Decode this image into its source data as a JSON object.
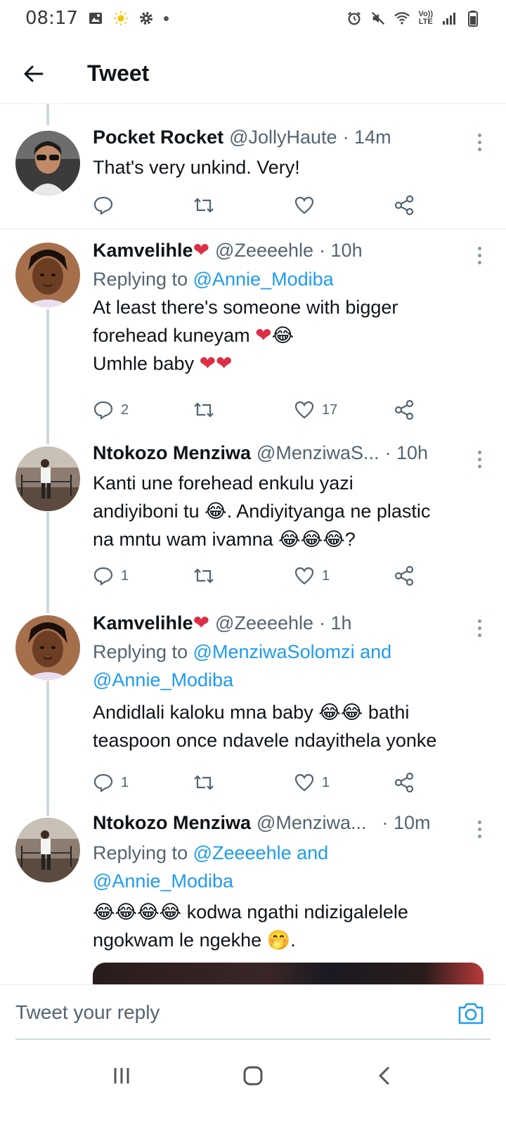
{
  "status_bar": {
    "time": "08:17",
    "left_icons": [
      "image-icon",
      "sun-icon",
      "settings-icon",
      "dot-icon"
    ],
    "right_icons": [
      "alarm-icon",
      "mute-icon",
      "wifi-icon",
      "volte-icon",
      "signal-icon",
      "battery-icon"
    ],
    "volte_label_top": "Vo))",
    "volte_label_bottom": "LTE"
  },
  "header": {
    "title": "Tweet"
  },
  "tweets": [
    {
      "name": "Pocket Rocket",
      "handle": "@JollyHaute",
      "time": "· 14m",
      "replying_prefix": "",
      "replying_to": "",
      "text_lines": [
        "That's very unkind. Very!"
      ],
      "replies": "",
      "likes": ""
    },
    {
      "name": "Kamvelihle",
      "handle": "@Zeeeehle",
      "time": "· 10h",
      "replying_prefix": "Replying to",
      "replying_to": "@Annie_Modiba",
      "text_lines": [
        "At least there's someone with bigger",
        "forehead kuneyam",
        "Umhle baby"
      ],
      "replies": "2",
      "likes": "17"
    },
    {
      "name": "Ntokozo Menziwa",
      "handle": "@MenziwaS...",
      "time": "· 10h",
      "replying_prefix": "",
      "replying_to": "",
      "text_lines": [
        "Kanti une forehead enkulu yazi",
        "andiyiboni tu",
        ". Andiyityanga ne plastic",
        "na mntu wam ivamna",
        "?"
      ],
      "replies": "1",
      "likes": "1"
    },
    {
      "name": "Kamvelihle",
      "handle": "@Zeeeehle",
      "time": "· 1h",
      "replying_prefix": "Replying to",
      "replying_to": "@MenziwaSolomzi and",
      "replying_to_2": "@Annie_Modiba",
      "text_lines": [
        "Andidlali kaloku mna baby",
        "bathi",
        "teaspoon once ndavele ndayithela yonke"
      ],
      "replies": "1",
      "likes": "1"
    },
    {
      "name": "Ntokozo Menziwa",
      "handle": "@Menziwa...",
      "time": "· 10m",
      "replying_prefix": "Replying to",
      "replying_to": "@Zeeeehle and",
      "replying_to_2": "@Annie_Modiba",
      "text_lines": [
        "kodwa ngathi ndizigalelele",
        "ngokwam le ngekhe",
        "."
      ]
    }
  ],
  "reply_bar": {
    "placeholder": "Tweet your reply"
  },
  "colors": {
    "accent": "#1d9bf0",
    "text": "#0f1419",
    "secondary": "#536471",
    "divider": "#e6ecf0",
    "heart": "#dd2e44"
  }
}
